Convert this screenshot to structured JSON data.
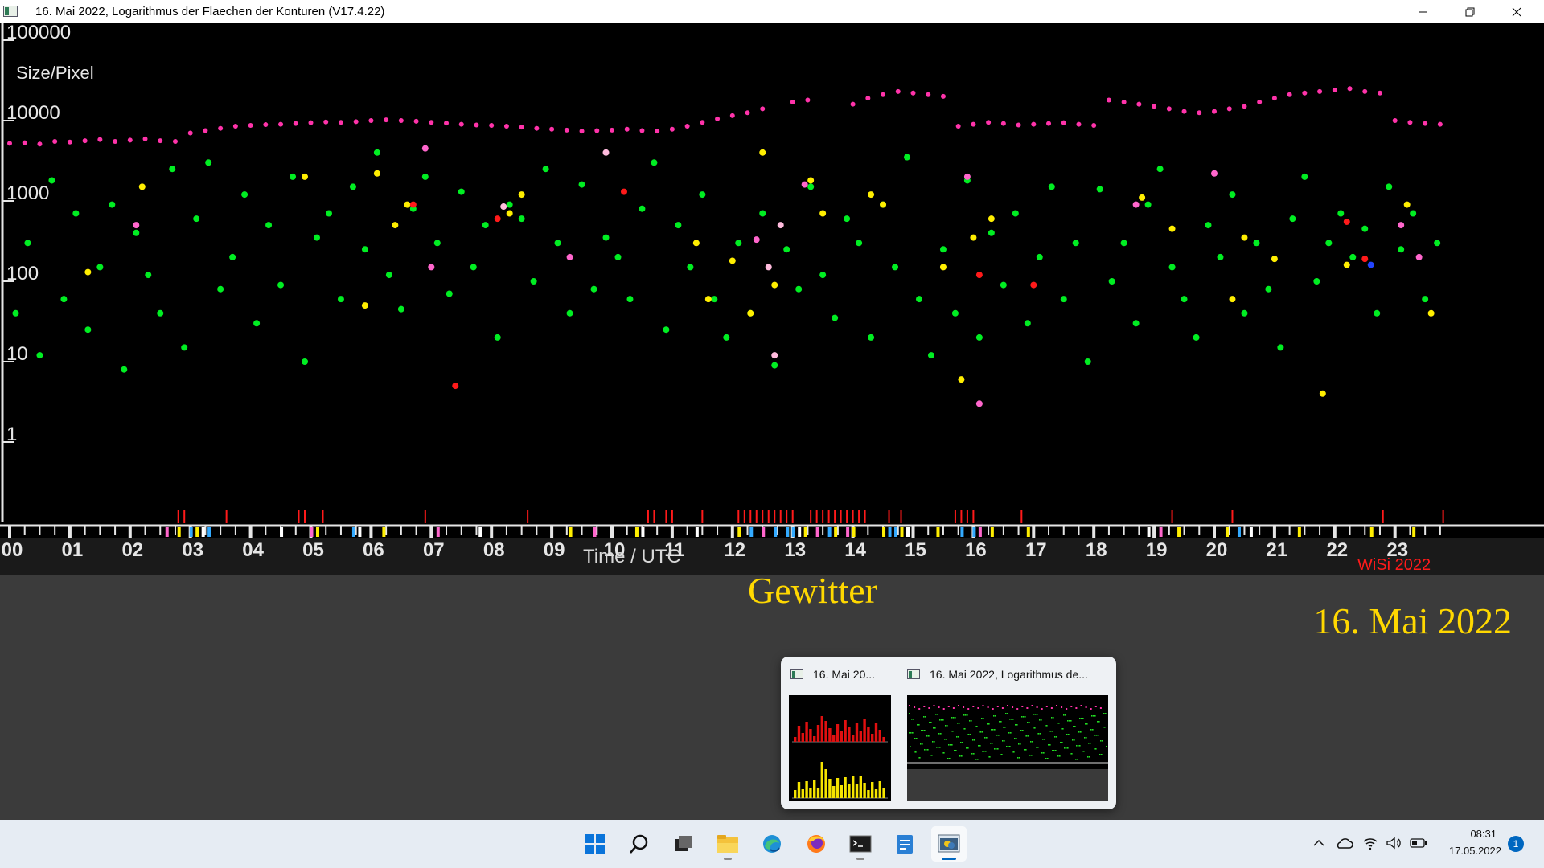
{
  "window": {
    "title": "16. Mai 2022, Logarithmus der Flaechen der Konturen (V17.4.22)",
    "controls": [
      "minimize",
      "maximize",
      "close"
    ]
  },
  "chart_data": {
    "type": "scatter",
    "title": "",
    "ylabel": "Size/Pixel",
    "xlabel": "Time / UTC",
    "watermark": "WiSi 2022",
    "y_scale": "log",
    "ylim": [
      1,
      100000
    ],
    "y_ticks": [
      "100000",
      "10000",
      "1000",
      "100",
      "10",
      "1"
    ],
    "xlim": [
      0,
      24
    ],
    "x_ticks": [
      "00",
      "01",
      "02",
      "03",
      "04",
      "05",
      "06",
      "07",
      "08",
      "09",
      "10",
      "11",
      "12",
      "13",
      "14",
      "15",
      "16",
      "17",
      "18",
      "19",
      "20",
      "21",
      "22",
      "23"
    ],
    "grid": false,
    "series": [
      {
        "color": "#ff33aa",
        "x": [
          0.0,
          0.25,
          0.5,
          0.75,
          1.0,
          1.25,
          1.5,
          1.75,
          2.0,
          2.25,
          2.5,
          2.75,
          3.0,
          3.25,
          3.5,
          3.75,
          4.0,
          4.25,
          4.5,
          4.75,
          5.0,
          5.25,
          5.5,
          5.75,
          6.0,
          6.25,
          6.5,
          6.75,
          7.0,
          7.25,
          7.5,
          7.75,
          8.0,
          8.25,
          8.5,
          8.75,
          9.0,
          9.25,
          9.5,
          9.75,
          10.0,
          10.25,
          10.5,
          10.75,
          11.0,
          11.25,
          11.5,
          11.75,
          12.0,
          12.25,
          12.5,
          13.0,
          13.25,
          14.0,
          14.25,
          14.5,
          14.75,
          15.0,
          15.25,
          15.5,
          15.75,
          16.0,
          16.25,
          16.5,
          16.75,
          17.0,
          17.25,
          17.5,
          17.75,
          18.0,
          18.25,
          18.5,
          18.75,
          19.0,
          19.25,
          19.5,
          19.75,
          20.0,
          20.25,
          20.5,
          20.75,
          21.0,
          21.25,
          21.5,
          21.75,
          22.0,
          22.25,
          22.5,
          22.75,
          23.0,
          23.25,
          23.5,
          23.75
        ],
        "y": [
          5200,
          5300,
          5100,
          5500,
          5400,
          5600,
          5800,
          5500,
          5700,
          5900,
          5600,
          5500,
          7000,
          7500,
          8000,
          8500,
          8700,
          8900,
          9000,
          9200,
          9400,
          9600,
          9500,
          9700,
          10000,
          10200,
          10000,
          9800,
          9500,
          9300,
          9000,
          8800,
          8700,
          8500,
          8300,
          8000,
          7800,
          7600,
          7400,
          7500,
          7600,
          7800,
          7500,
          7400,
          7800,
          8500,
          9500,
          10500,
          11500,
          12500,
          14000,
          17000,
          18000,
          16000,
          19000,
          21000,
          23000,
          22000,
          21000,
          20000,
          8500,
          9000,
          9500,
          9200,
          8800,
          9000,
          9200,
          9400,
          9000,
          8700,
          18000,
          17000,
          16000,
          15000,
          14000,
          13000,
          12500,
          13000,
          14000,
          15000,
          17000,
          19000,
          21000,
          22000,
          23000,
          24000,
          25000,
          23000,
          22000,
          10000,
          9500,
          9200,
          9000
        ]
      },
      {
        "color": "#00ee22",
        "x": [
          0.1,
          0.3,
          0.5,
          0.7,
          0.9,
          1.1,
          1.3,
          1.5,
          1.7,
          1.9,
          2.1,
          2.3,
          2.5,
          2.7,
          2.9,
          3.1,
          3.3,
          3.5,
          3.7,
          3.9,
          4.1,
          4.3,
          4.5,
          4.7,
          4.9,
          5.1,
          5.3,
          5.5,
          5.7,
          5.9,
          6.1,
          6.3,
          6.5,
          6.7,
          6.9,
          7.1,
          7.3,
          7.5,
          7.7,
          7.9,
          8.1,
          8.3,
          8.5,
          8.7,
          8.9,
          9.1,
          9.3,
          9.5,
          9.7,
          9.9,
          10.1,
          10.3,
          10.5,
          10.7,
          10.9,
          11.1,
          11.3,
          11.5,
          11.7,
          11.9,
          12.1,
          12.3,
          12.5,
          12.7,
          12.9,
          13.1,
          13.3,
          13.5,
          13.7,
          13.9,
          14.1,
          14.3,
          14.5,
          14.7,
          14.9,
          15.1,
          15.3,
          15.5,
          15.7,
          15.9,
          16.1,
          16.3,
          16.5,
          16.7,
          16.9,
          17.1,
          17.3,
          17.5,
          17.7,
          17.9,
          18.1,
          18.3,
          18.5,
          18.7,
          18.9,
          19.1,
          19.3,
          19.5,
          19.7,
          19.9,
          20.1,
          20.3,
          20.5,
          20.7,
          20.9,
          21.1,
          21.3,
          21.5,
          21.7,
          21.9,
          22.1,
          22.3,
          22.5,
          22.7,
          22.9,
          23.1,
          23.3,
          23.5,
          23.7
        ],
        "y": [
          40,
          300,
          12,
          1800,
          60,
          700,
          25,
          150,
          900,
          8,
          400,
          120,
          40,
          2500,
          15,
          600,
          3000,
          80,
          200,
          1200,
          30,
          500,
          90,
          2000,
          10,
          350,
          700,
          60,
          1500,
          250,
          4000,
          120,
          45,
          800,
          2000,
          300,
          70,
          1300,
          150,
          500,
          20,
          900,
          600,
          100,
          2500,
          300,
          40,
          1600,
          80,
          350,
          200,
          60,
          800,
          3000,
          25,
          500,
          150,
          1200,
          60,
          20,
          300,
          40,
          700,
          9,
          250,
          80,
          1500,
          120,
          35,
          600,
          300,
          20,
          900,
          150,
          3500,
          60,
          12,
          250,
          40,
          1800,
          20,
          400,
          90,
          700,
          30,
          200,
          1500,
          60,
          300,
          10,
          1400,
          100,
          300,
          30,
          900,
          2500,
          150,
          60,
          20,
          500,
          200,
          1200,
          40,
          300,
          80,
          15,
          600,
          2000,
          100,
          300,
          700,
          200,
          450,
          40,
          1500,
          250,
          700,
          60,
          300
        ]
      },
      {
        "color": "#ffee00",
        "x": [
          1.3,
          2.2,
          4.9,
          5.9,
          6.1,
          6.4,
          6.6,
          8.3,
          8.5,
          11.4,
          11.6,
          12.0,
          12.3,
          12.5,
          12.7,
          13.3,
          13.5,
          14.3,
          14.5,
          15.5,
          15.8,
          16.0,
          16.3,
          18.8,
          19.3,
          20.3,
          20.5,
          21.0,
          21.8,
          22.2,
          23.2,
          23.6
        ],
        "y": [
          130,
          1500,
          2000,
          50,
          2200,
          500,
          900,
          700,
          1200,
          300,
          60,
          180,
          40,
          4000,
          90,
          1800,
          700,
          1200,
          900,
          150,
          6,
          350,
          600,
          1100,
          450,
          60,
          350,
          190,
          4,
          160,
          900,
          40
        ]
      },
      {
        "color": "#ff1a1a",
        "x": [
          6.7,
          7.4,
          8.1,
          10.2,
          16.1,
          17.0,
          22.2,
          22.5
        ],
        "y": [
          900,
          5,
          600,
          1300,
          120,
          90,
          550,
          190
        ]
      },
      {
        "color": "#ff66cc",
        "x": [
          2.1,
          6.9,
          7.0,
          9.3,
          12.4,
          13.2,
          15.9,
          16.1,
          18.7,
          20.0,
          23.1,
          23.4
        ],
        "y": [
          500,
          4500,
          150,
          200,
          330,
          1600,
          2000,
          3,
          900,
          2200,
          500,
          200
        ]
      },
      {
        "color": "#ffbbdd",
        "x": [
          8.2,
          9.9,
          12.6,
          12.8,
          12.7
        ],
        "y": [
          850,
          4000,
          150,
          500,
          12
        ]
      },
      {
        "color": "#2244ff",
        "x": [
          22.6
        ],
        "y": [
          160
        ]
      }
    ],
    "strip_marks": [
      {
        "color": "#ff1a1a",
        "x": [
          2.8,
          2.9,
          3.6,
          4.8,
          4.9,
          5.2,
          6.9,
          8.6,
          10.6,
          10.7,
          10.9,
          11.0,
          11.5,
          12.1,
          12.2,
          12.3,
          12.4,
          12.5,
          12.6,
          12.7,
          12.8,
          12.9,
          13.0,
          13.3,
          13.4,
          13.5,
          13.6,
          13.7,
          13.8,
          13.9,
          14.0,
          14.1,
          14.2,
          14.6,
          14.8,
          15.7,
          15.8,
          15.9,
          16.0,
          16.8,
          19.3,
          20.3,
          22.8,
          23.8
        ]
      },
      {
        "color": "#ffee00",
        "x": [
          2.8,
          3.1,
          5.1,
          6.2,
          9.3,
          10.4,
          12.1,
          12.9,
          13.2,
          13.7,
          14.0,
          14.5,
          14.8,
          15.4,
          16.3,
          16.9,
          19.4,
          20.2,
          21.4,
          22.6,
          23.3
        ]
      },
      {
        "color": "#33aaff",
        "x": [
          3.0,
          3.3,
          5.7,
          12.3,
          12.7,
          12.9,
          13.0,
          13.6,
          14.6,
          14.7,
          15.8,
          16.0,
          20.4
        ]
      },
      {
        "color": "#ff66cc",
        "x": [
          2.6,
          5.0,
          7.1,
          9.7,
          12.5,
          13.4,
          13.9,
          16.1,
          19.1
        ]
      },
      {
        "color": "#ffffff",
        "x": [
          3.2,
          4.5,
          5.8,
          7.8,
          10.5,
          11.4,
          13.1,
          14.9,
          18.9,
          20.6
        ]
      }
    ]
  },
  "overlay": {
    "label": "Gewitter",
    "date": "16. Mai 2022"
  },
  "taskbar_preview": {
    "windows": [
      {
        "title": "16. Mai 20..."
      },
      {
        "title": "16. Mai 2022, Logarithmus de..."
      }
    ]
  },
  "taskbar": {
    "apps": [
      "start-icon",
      "search-icon",
      "task-view-icon",
      "file-explorer-icon",
      "edge-icon",
      "firefox-icon",
      "terminal-icon",
      "notepad-icon",
      "python-icon"
    ],
    "active_app": "python-icon",
    "clock_time": "08:31",
    "clock_date": "17.05.2022",
    "notification_count": "1"
  }
}
